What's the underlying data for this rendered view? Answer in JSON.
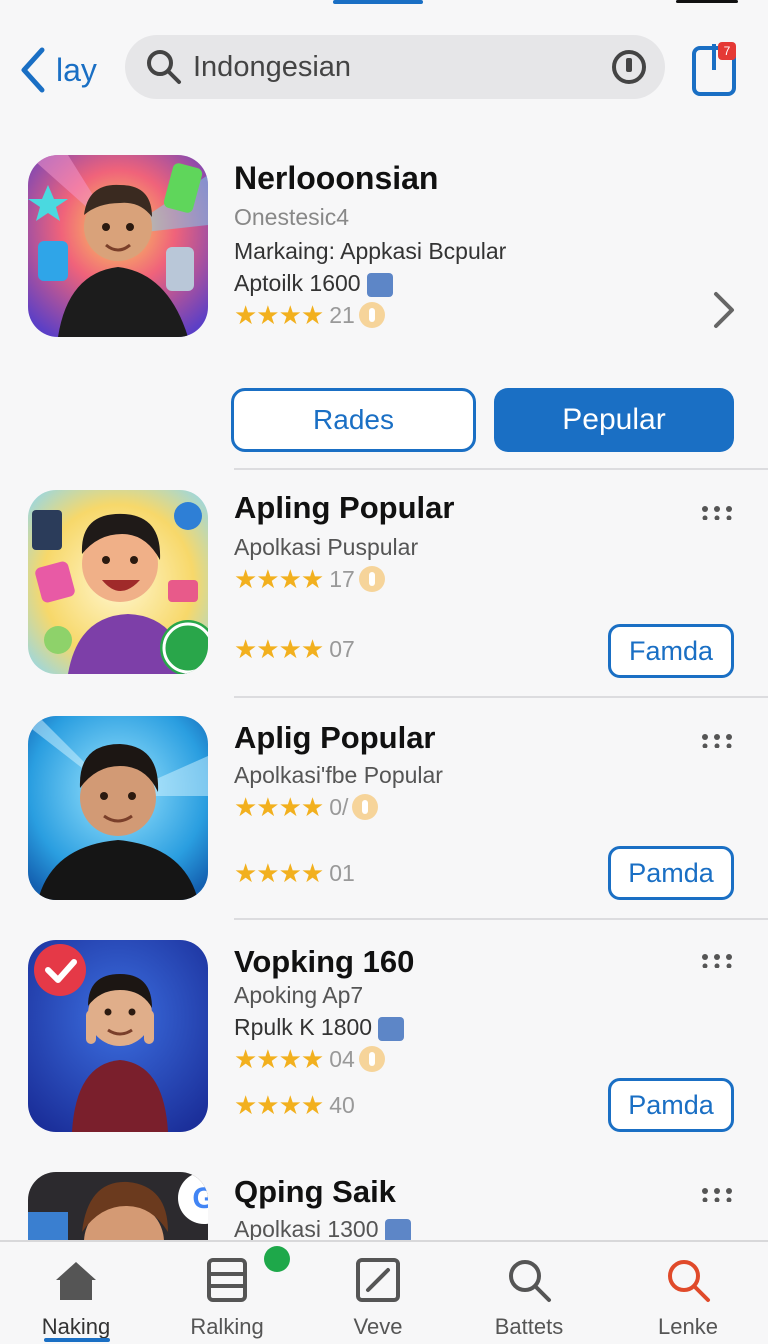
{
  "header": {
    "back_label": "lay",
    "search_value": "Indongesian",
    "cart_badge": "7"
  },
  "featured": {
    "title": "Nerlooonsian",
    "subtitle": "Onestesic4",
    "line1": "Markaing: Appkasi Bcpular",
    "line2": "Aptoilk 1600",
    "stars": "★★★★",
    "rating": "21",
    "btn_outline": "Rades",
    "btn_solid": "Pepular"
  },
  "items": [
    {
      "title": "Apling Popular",
      "subtitle": "Apolkasi  Puspular",
      "stars1": "★★★★",
      "rating1": "17",
      "stars2": "★★★★",
      "rating2": "07",
      "button": "Famda"
    },
    {
      "title": "Aplig Popular",
      "subtitle": "Apolkasi'fbe Popular",
      "stars1": "★★★★",
      "rating1": "0/",
      "stars2": "★★★★",
      "rating2": "01",
      "button": "Pamda"
    },
    {
      "title": "Vopking 160",
      "subtitle": "Apoking Ap7",
      "line2": "Rpulk K 1800",
      "stars1": "★★★★",
      "rating1": "04",
      "stars2": "★★★★",
      "rating2": "40",
      "button": "Pamda"
    },
    {
      "title": "Qping Saik",
      "subtitle": "Apolkasi 1300"
    }
  ],
  "nav": [
    {
      "label": "Naking",
      "icon": "home-icon"
    },
    {
      "label": "Ralking",
      "icon": "stack-icon"
    },
    {
      "label": "Veve",
      "icon": "edit-icon"
    },
    {
      "label": "Battets",
      "icon": "search-icon"
    },
    {
      "label": "Lenke",
      "icon": "search-red-icon"
    }
  ],
  "colors": {
    "accent": "#1a6fc4",
    "star": "#f2b01e",
    "badge_red": "#e53935",
    "badge_green": "#1ea84a"
  }
}
